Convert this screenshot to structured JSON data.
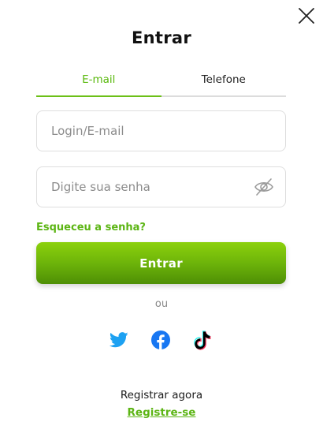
{
  "dialog": {
    "title": "Entrar",
    "close_icon": "close-icon"
  },
  "tabs": [
    {
      "label": "E-mail",
      "active": true
    },
    {
      "label": "Telefone",
      "active": false
    }
  ],
  "form": {
    "login_placeholder": "Login/E-mail",
    "login_value": "",
    "password_placeholder": "Digite sua senha",
    "password_value": "",
    "password_toggle_icon": "eye-off-icon",
    "forgot_label": "Esqueceu a senha?",
    "submit_label": "Entrar"
  },
  "divider_text": "ou",
  "social": [
    {
      "name": "Twitter",
      "icon": "twitter-icon",
      "color": "#1DA1F2"
    },
    {
      "name": "Facebook",
      "icon": "facebook-icon",
      "color": "#1877F2"
    },
    {
      "name": "TikTok",
      "icon": "tiktok-icon",
      "color": "#000000"
    }
  ],
  "footer": {
    "prompt": "Registrar agora",
    "register_link": "Registre-se"
  },
  "colors": {
    "accent": "#5cb514",
    "button_top": "#8cd10c",
    "button_bottom": "#4e8f05"
  }
}
